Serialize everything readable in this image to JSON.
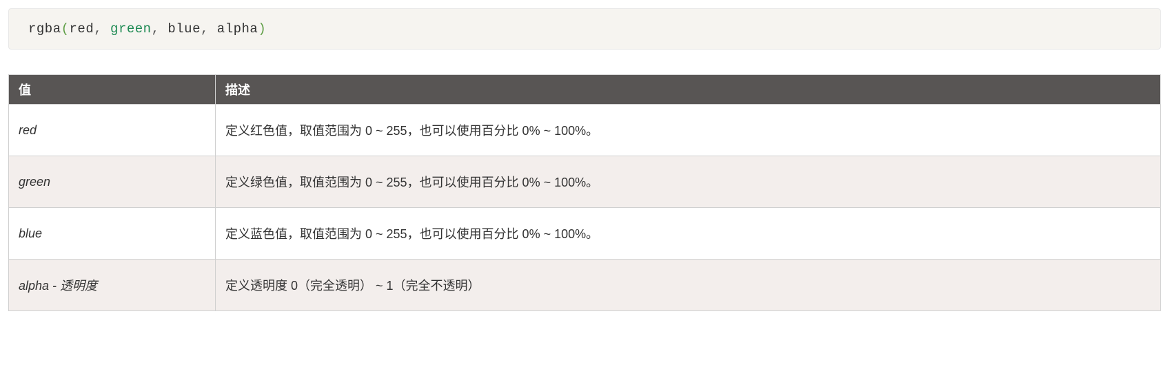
{
  "code": {
    "fn": "rgba",
    "open": "(",
    "close": ")",
    "sep": ", ",
    "args": [
      "red",
      "green",
      "blue",
      "alpha"
    ]
  },
  "table": {
    "headers": [
      "值",
      "描述"
    ],
    "rows": [
      {
        "value": "red",
        "desc": "定义红色值，取值范围为 0 ~ 255，也可以使用百分比 0% ~ 100%。"
      },
      {
        "value": "green",
        "desc": "定义绿色值，取值范围为 0 ~ 255，也可以使用百分比 0% ~ 100%。"
      },
      {
        "value": "blue",
        "desc": "定义蓝色值，取值范围为 0 ~ 255，也可以使用百分比 0% ~ 100%。"
      },
      {
        "value": "alpha - 透明度",
        "desc": "定义透明度 0（完全透明） ~ 1（完全不透明）"
      }
    ]
  }
}
